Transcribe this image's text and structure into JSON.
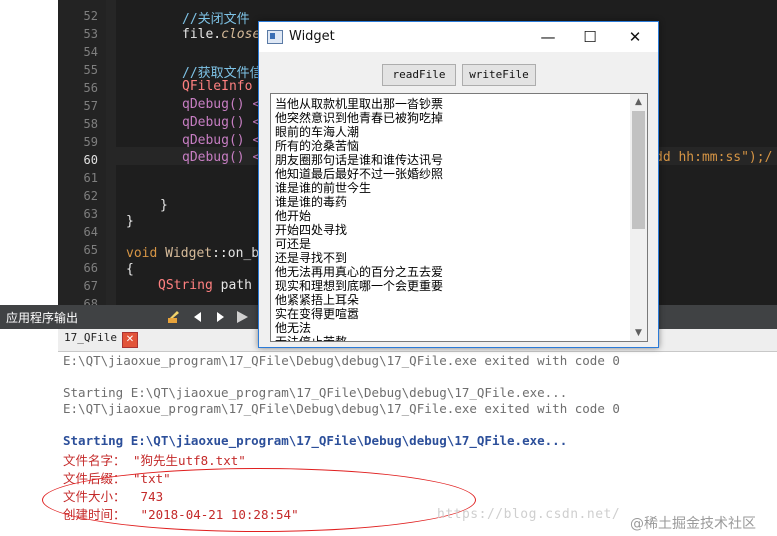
{
  "editor": {
    "line_numbers": [
      "52",
      "53",
      "54",
      "55",
      "56",
      "57",
      "58",
      "59",
      "60",
      "61",
      "62",
      "63",
      "64",
      "65",
      "66",
      "67",
      "68"
    ],
    "current_line": "60",
    "code": {
      "l52": "//关闭文件",
      "l53_obj": "file.",
      "l53_call": "close",
      "l55": "//获取文件信",
      "l56": "QFileInfo",
      "l57": "qDebug() <",
      "l58": "qDebug() <",
      "l59": "qDebug() <",
      "l60": "qDebug() <",
      "l60_tail": "dd hh:mm:ss\");/",
      "l63": "}",
      "l64": "}",
      "l66_kw": "void",
      "l66_cls": "Widget",
      "l66_rest": "::on_b",
      "l67": "{",
      "l68_type": "QString",
      "l68_rest": " path"
    }
  },
  "output": {
    "pane_title": "应用程序输出",
    "tab_label": "17_QFile",
    "tab_close": "✕",
    "lines": {
      "l1": "E:\\QT\\jiaoxue_program\\17_QFile\\Debug\\debug\\17_QFile.exe exited with code 0",
      "l2": "Starting E:\\QT\\jiaoxue_program\\17_QFile\\Debug\\debug\\17_QFile.exe...",
      "l3": "E:\\QT\\jiaoxue_program\\17_QFile\\Debug\\debug\\17_QFile.exe exited with code 0",
      "l4": "Starting E:\\QT\\jiaoxue_program\\17_QFile\\Debug\\debug\\17_QFile.exe...",
      "l5": "文件名字： \"狗先生utf8.txt\"",
      "l6": "文件后缀： \"txt\"",
      "l7": "文件大小：  743",
      "l8": "创建时间：  \"2018-04-21 10:28:54\""
    }
  },
  "widget": {
    "title": "Widget",
    "minimize": "—",
    "maximize": "☐",
    "close": "✕",
    "read_button": "readFile",
    "write_button": "writeFile",
    "scroll_up": "▲",
    "scroll_down": "▼",
    "text_lines": [
      "当他从取款机里取出那一沓钞票",
      "他突然意识到他青春已被狗吃掉",
      "眼前的车海人潮",
      "所有的沧桑苦恼",
      "朋友圈那句话是谁和谁传达讯号",
      "他知道最后最好不过一张婚纱照",
      "谁是谁的前世今生",
      "谁是谁的毒药",
      "他开始",
      "开始四处寻找",
      "可还是",
      "还是寻找不到",
      "他无法再用真心的百分之五去爱",
      "现实和理想到底哪一个会更重要",
      "他紧紧捂上耳朵",
      "实在变得更喧嚣",
      "他无法",
      "无法停止苦熬"
    ]
  },
  "watermark": {
    "url": "https://blog.csdn.net/",
    "site": "@稀土掘金技术社区"
  },
  "colors": {
    "editor_bg": "#1e1e1e",
    "comment": "#7ec3e6",
    "highlight_red": "#e02020"
  }
}
